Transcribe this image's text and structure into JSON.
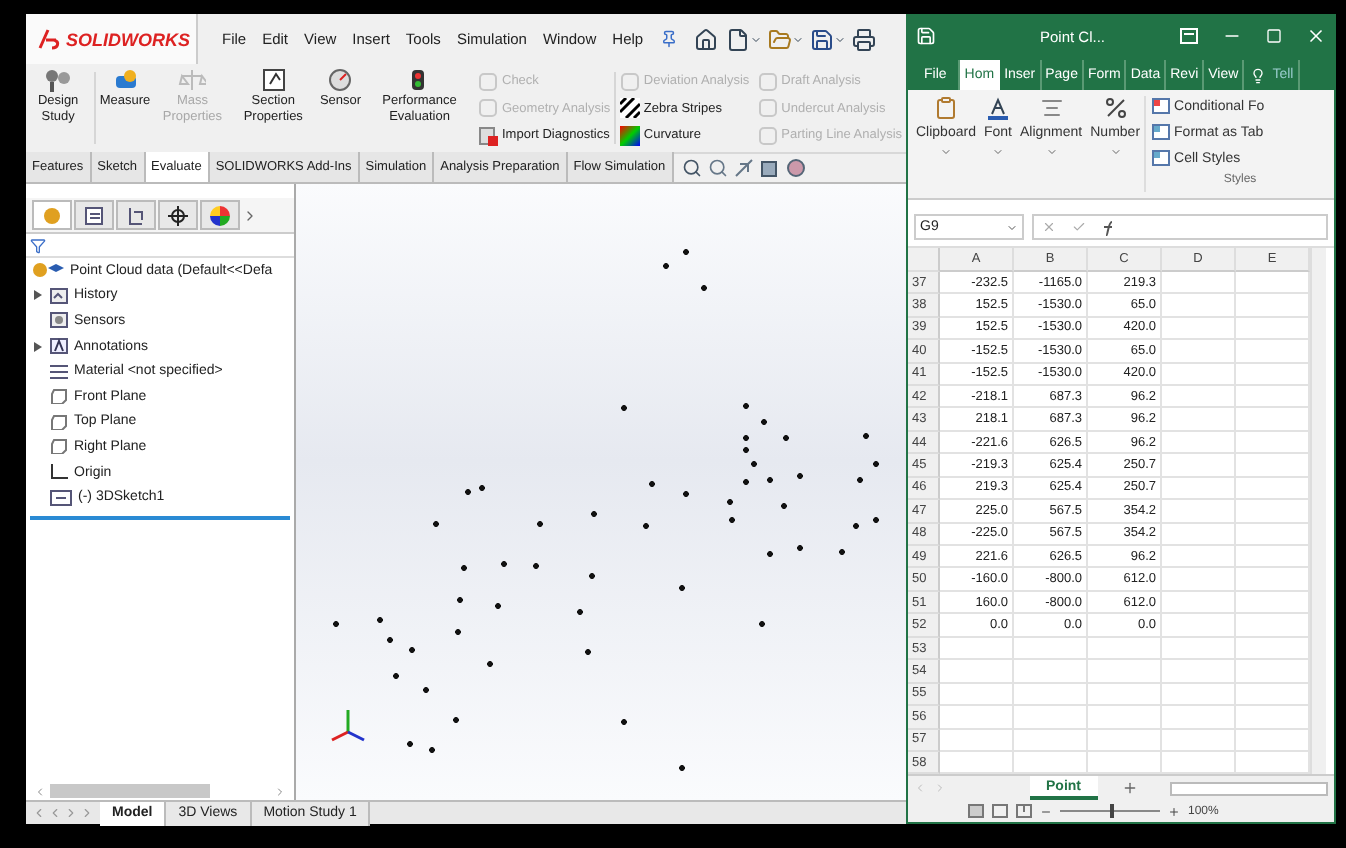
{
  "solidworks": {
    "logo": "SOLIDWORKS",
    "menu": [
      "File",
      "Edit",
      "View",
      "Insert",
      "Tools",
      "Simulation",
      "Window",
      "Help"
    ],
    "big_buttons": [
      {
        "kind": "study",
        "label": "Design Study",
        "disabled": false
      },
      {
        "kind": "measure",
        "label": "Measure",
        "disabled": false
      },
      {
        "kind": "mass",
        "label": "Mass Properties",
        "disabled": true
      },
      {
        "kind": "section",
        "label": "Section Properties",
        "disabled": false
      },
      {
        "kind": "sensor",
        "label": "Sensor",
        "disabled": false
      },
      {
        "kind": "performance",
        "label": "Performance Evaluation",
        "disabled": false
      }
    ],
    "small_columns": [
      [
        {
          "kind": "check",
          "label": "Check",
          "disabled": true
        },
        {
          "kind": "geometry",
          "label": "Geometry Analysis",
          "disabled": true
        },
        {
          "kind": "import",
          "label": "Import Diagnostics",
          "disabled": false
        }
      ],
      [
        {
          "kind": "deviation",
          "label": "Deviation Analysis",
          "disabled": true
        },
        {
          "kind": "zebra",
          "label": "Zebra Stripes",
          "disabled": false
        },
        {
          "kind": "curvature",
          "label": "Curvature",
          "disabled": false
        }
      ],
      [
        {
          "kind": "draft",
          "label": "Draft Analysis",
          "disabled": true
        },
        {
          "kind": "undercut",
          "label": "Undercut Analysis",
          "disabled": true
        },
        {
          "kind": "parting",
          "label": "Parting Line Analysis",
          "disabled": true
        }
      ]
    ],
    "tabs": [
      {
        "label": "Features",
        "selected": false
      },
      {
        "label": "Sketch",
        "selected": false
      },
      {
        "label": "Evaluate",
        "selected": true
      },
      {
        "label": "SOLIDWORKS Add-Ins",
        "selected": false
      },
      {
        "label": "Simulation",
        "selected": false
      },
      {
        "label": "Analysis Preparation",
        "selected": false
      },
      {
        "label": "Flow Simulation",
        "selected": false
      }
    ],
    "tree": {
      "label": "Point Cloud data  (Default<<Defa",
      "children": [
        {
          "kind": "history",
          "label": "History",
          "expandable": true
        },
        {
          "kind": "sensors",
          "label": "Sensors",
          "expandable": false
        },
        {
          "kind": "annotations",
          "label": "Annotations",
          "expandable": true
        },
        {
          "kind": "material",
          "label": "Material <not specified>",
          "expandable": false
        },
        {
          "kind": "plane",
          "label": "Front Plane",
          "expandable": false
        },
        {
          "kind": "plane",
          "label": "Top Plane",
          "expandable": false
        },
        {
          "kind": "plane",
          "label": "Right Plane",
          "expandable": false
        },
        {
          "kind": "origin",
          "label": "Origin",
          "expandable": false
        },
        {
          "kind": "sketch",
          "label": "(-) 3DSketch1",
          "expandable": false
        }
      ]
    },
    "bottom_tabs": [
      {
        "label": "Model",
        "selected": true
      },
      {
        "label": "3D Views",
        "selected": false
      },
      {
        "label": "Motion Study 1",
        "selected": false
      }
    ]
  },
  "excel": {
    "title": "Point Cl...",
    "tabs": [
      {
        "label": "File",
        "selected": false
      },
      {
        "label": "Hom",
        "selected": true
      },
      {
        "label": "Inser",
        "selected": false
      },
      {
        "label": "Page",
        "selected": false
      },
      {
        "label": "Form",
        "selected": false
      },
      {
        "label": "Data",
        "selected": false
      },
      {
        "label": "Revi",
        "selected": false
      },
      {
        "label": "View",
        "selected": false
      }
    ],
    "tell": "Tell",
    "groups": [
      {
        "kind": "clipboard",
        "label": "Clipboard"
      },
      {
        "kind": "font",
        "label": "Font"
      },
      {
        "kind": "alignment",
        "label": "Alignment"
      },
      {
        "kind": "number",
        "label": "Number"
      }
    ],
    "styles": {
      "items": [
        "Conditional Fo",
        "Format as Tab",
        "Cell Styles"
      ],
      "label": "Styles"
    },
    "name_box": "G9",
    "columns": [
      "A",
      "B",
      "C",
      "D",
      "E"
    ],
    "rows": [
      {
        "n": "37",
        "cells": [
          "-232.5",
          "-1165.0",
          "219.3"
        ]
      },
      {
        "n": "38",
        "cells": [
          "152.5",
          "-1530.0",
          "65.0"
        ]
      },
      {
        "n": "39",
        "cells": [
          "152.5",
          "-1530.0",
          "420.0"
        ]
      },
      {
        "n": "40",
        "cells": [
          "-152.5",
          "-1530.0",
          "65.0"
        ]
      },
      {
        "n": "41",
        "cells": [
          "-152.5",
          "-1530.0",
          "420.0"
        ]
      },
      {
        "n": "42",
        "cells": [
          "-218.1",
          "687.3",
          "96.2"
        ]
      },
      {
        "n": "43",
        "cells": [
          "218.1",
          "687.3",
          "96.2"
        ]
      },
      {
        "n": "44",
        "cells": [
          "-221.6",
          "626.5",
          "96.2"
        ]
      },
      {
        "n": "45",
        "cells": [
          "-219.3",
          "625.4",
          "250.7"
        ]
      },
      {
        "n": "46",
        "cells": [
          "219.3",
          "625.4",
          "250.7"
        ]
      },
      {
        "n": "47",
        "cells": [
          "225.0",
          "567.5",
          "354.2"
        ]
      },
      {
        "n": "48",
        "cells": [
          "-225.0",
          "567.5",
          "354.2"
        ]
      },
      {
        "n": "49",
        "cells": [
          "221.6",
          "626.5",
          "96.2"
        ]
      },
      {
        "n": "50",
        "cells": [
          "-160.0",
          "-800.0",
          "612.0"
        ]
      },
      {
        "n": "51",
        "cells": [
          "160.0",
          "-800.0",
          "612.0"
        ]
      },
      {
        "n": "52",
        "cells": [
          "0.0",
          "0.0",
          "0.0"
        ]
      },
      {
        "n": "53",
        "cells": []
      },
      {
        "n": "54",
        "cells": []
      },
      {
        "n": "55",
        "cells": []
      },
      {
        "n": "56",
        "cells": []
      },
      {
        "n": "57",
        "cells": []
      },
      {
        "n": "58",
        "cells": []
      }
    ],
    "sheet": {
      "label": "Point",
      "selected": true
    },
    "zoom": {
      "level": 0.5,
      "reading": "100%"
    }
  }
}
